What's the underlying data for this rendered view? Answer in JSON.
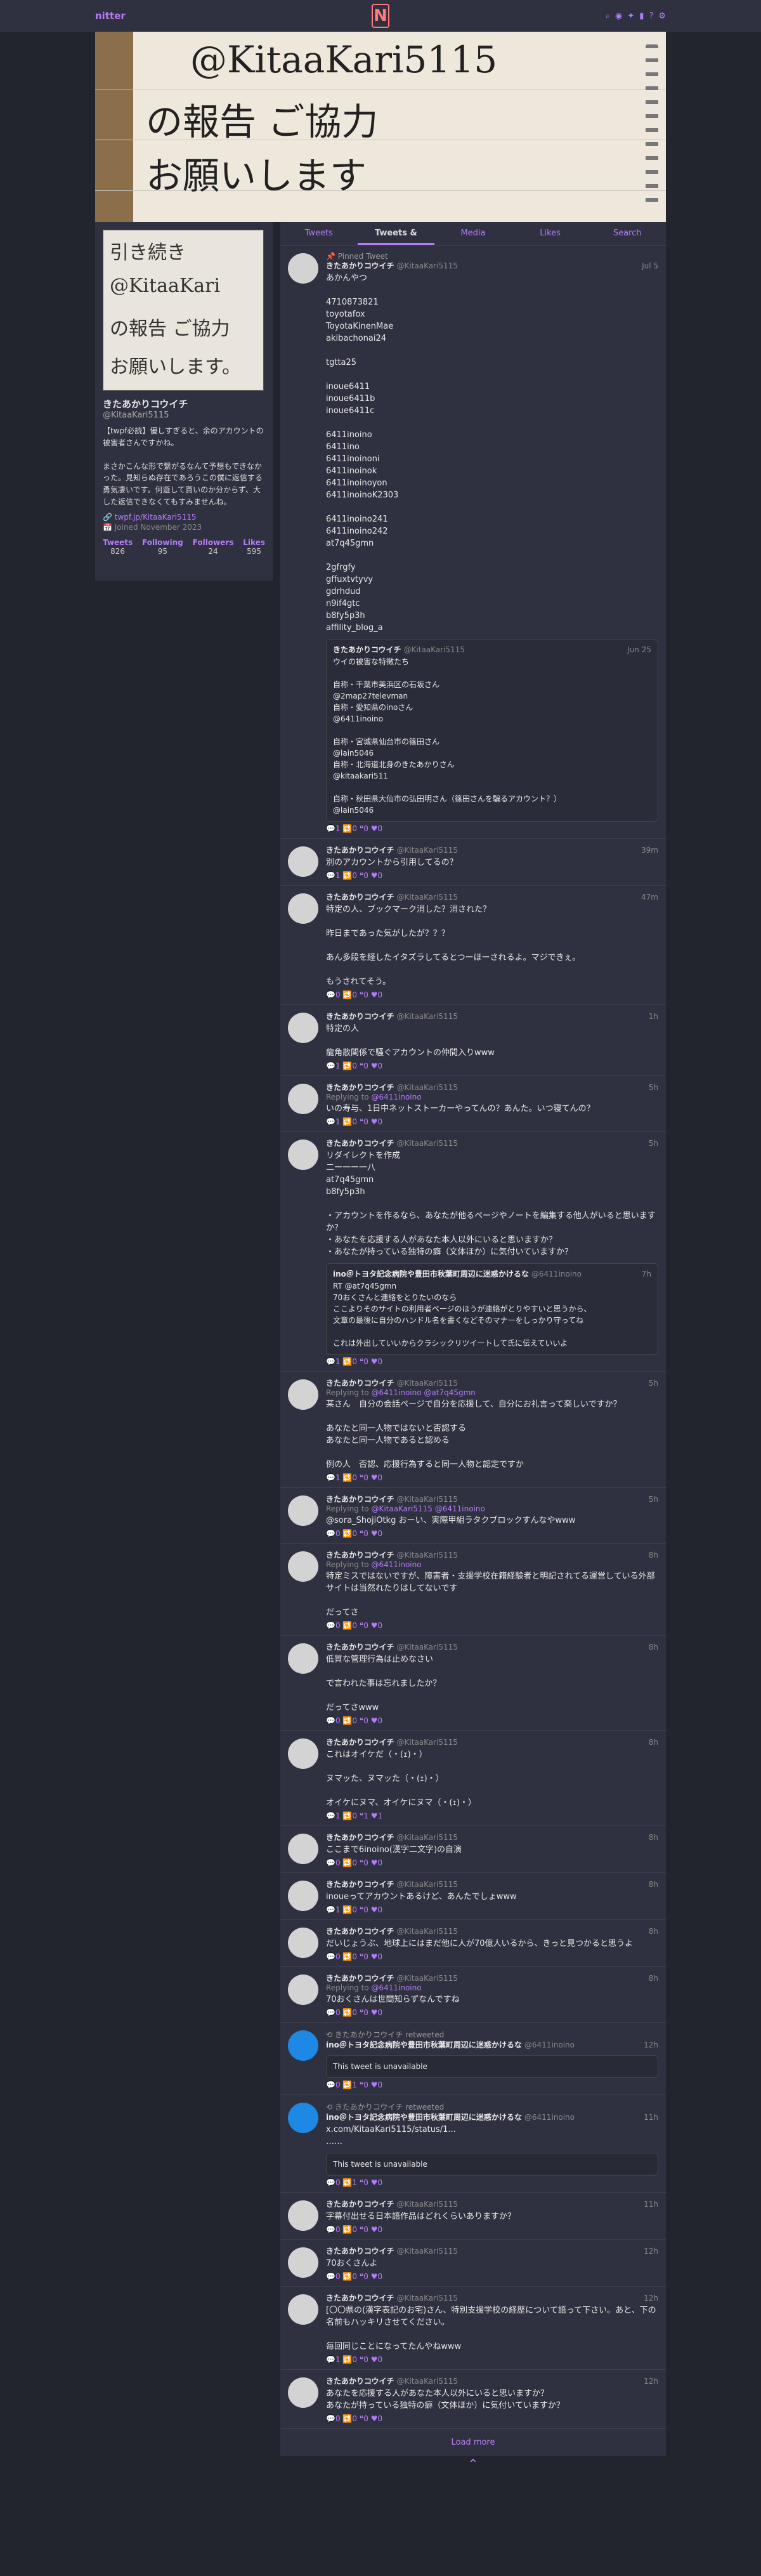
{
  "nav": {
    "brand": "nitter",
    "logo": "N",
    "icons": [
      "search-icon",
      "rss-icon",
      "twitter-icon",
      "chart-icon",
      "help-icon",
      "gear-icon"
    ]
  },
  "banner": {
    "lines": [
      "@KitaaKari5115",
      "の報告 ご協力",
      "お願いします"
    ]
  },
  "profile": {
    "avatar_lines": [
      "引き続き",
      "@KitaaKari",
      "の報告 ご協力",
      "お願いします。"
    ],
    "fullname": "きたあかりコウイチ",
    "username": "@KitaaKari5115",
    "bio": "【twpf必読】優しすぎると、余のアカウントの被害者さんですかね。\n\nまさかこんな形で繋がるなんて予想もできなかった。見知らぬ存在であろうこの僕に返信する勇気凄いです。何遊して貰いのか分からず、大した返信できなくてもすみませんね。",
    "link": "twpf.jp/KitaaKari5115",
    "joined": "Joined November 2023",
    "stats": [
      {
        "label": "Tweets",
        "value": "826"
      },
      {
        "label": "Following",
        "value": "95"
      },
      {
        "label": "Followers",
        "value": "24"
      },
      {
        "label": "Likes",
        "value": "595"
      }
    ]
  },
  "tabs": [
    "Tweets",
    "Tweets & Replies",
    "Media",
    "Likes",
    "Search"
  ],
  "tweets": [
    {
      "pinned": "Pinned Tweet",
      "fn": "きたあかりコウイチ",
      "un": "@KitaaKari5115",
      "date": "Jul 5",
      "body": "あかんやつ\n\n4710873821\ntoyotafox\nToyotaKinenMae\nakibachonai24\n\ntgtta25\n\ninoue6411\ninoue6411b\ninoue6411c\n\n6411inoino\n6411ino\n6411inoinoni\n6411inoinok\n6411inoinoyon\n6411inoinoK2303\n\n6411inoino241\n6411inoino242\nat7q45gmn\n\n2gfrgfy\ngffuxtvtyvy\ngdrhdud\nn9if4gtc\nb8fy5p3h\naffility_blog_a",
      "quote": {
        "fn": "きたあかりコウイチ",
        "un": "@KitaaKari5115",
        "date": "Jun 25",
        "body": "ウイの被害な特徴たち\n\n自称・千葉市美浜区の石坂さん\n@2map27televman\n自称・愛知県のinoさん\n@6411inoino\n\n自称・宮城県仙台市の篠田さん\n@lain5046\n自称・北海道北身のきたあかりさん\n@kitaakari511\n\n自称・秋田県大仙市の弘田明さん（篠田さんを騙るアカウント？）\n@lain5046"
      },
      "stats": "💬1 🔁0 ❝0 ♥0"
    },
    {
      "fn": "きたあかりコウイチ",
      "un": "@KitaaKari5115",
      "date": "39m",
      "body": "別のアカウントから引用してるの？",
      "stats": "💬1 🔁0 ❝0 ♥0"
    },
    {
      "fn": "きたあかりコウイチ",
      "un": "@KitaaKari5115",
      "date": "47m",
      "body": "特定の人、ブックマーク消した？消された？\n\n昨日まであった気がしたが？？？\n\nあん多段を経したイタズラしてるとつーほーされるよ。マジできぇ。\n\nもうされてそう。",
      "stats": "💬0 🔁0 ❝0 ♥0"
    },
    {
      "fn": "きたあかりコウイチ",
      "un": "@KitaaKari5115",
      "date": "1h",
      "body": "特定の人\n\n龍角散関係で騒ぐアカウントの仲間入りwww",
      "stats": "💬1 🔁0 ❝0 ♥0"
    },
    {
      "fn": "きたあかりコウイチ",
      "un": "@KitaaKari5115",
      "date": "5h",
      "reply": "@6411inoino",
      "body": "いの寿与、1日中ネットストーカーやってんの？あんた。いつ寝てんの？",
      "stats": "💬1 🔁0 ❝0 ♥0"
    },
    {
      "fn": "きたあかりコウイチ",
      "un": "@KitaaKari5115",
      "date": "5h",
      "body": "リダイレクトを作成\n二ー一ー一八\nat7q45gmn\nb8fy5p3h\n\n・アカウントを作るなら、あなたが他るページやノートを編集する他人がいると思いますか？\n・あなたを応援する人があなた本人以外にいると思いますか？\n・あなたが持っている独特の癖（文体ほか）に気付いていますか？",
      "quote": {
        "fn": "ino＠トヨタ記念病院や豊田市秋葉町周辺に迷惑かけるな",
        "un": "@6411inoino",
        "date": "7h",
        "body": "RT @at7q45gmn\n70おくさんと連絡をとりたいのなら\nここよりそのサイトの利用者ページのほうが連絡がとりやすいと思うから、\n文章の最後に自分のハンドル名を書くなどそのマナーをしっかり守ってね\n\nこれは外出していいからクラシックリツイートして氏に伝えていいよ"
      },
      "stats": "💬1 🔁0 ❝0 ♥0"
    },
    {
      "fn": "きたあかりコウイチ",
      "un": "@KitaaKari5115",
      "date": "5h",
      "reply": "@6411inoino @at7q45gmn",
      "body": "某さん　自分の会話ページで自分を応援して、自分にお礼言って楽しいですか？\n\nあなたと同一人物ではないと否認する\nあなたと同一人物であると認める\n\n例の人　否認、応援行為すると同一人物と認定ですか",
      "stats": "💬1 🔁0 ❝0 ♥0"
    },
    {
      "fn": "きたあかりコウイチ",
      "un": "@KitaaKari5115",
      "date": "5h",
      "reply": "@KitaaKari5115 @6411inoino",
      "body": "@sora_ShojiOtkg おーい、実際甲組ラタクブロックすんなやwww",
      "stats": "💬0 🔁0 ❝0 ♥0"
    },
    {
      "fn": "きたあかりコウイチ",
      "un": "@KitaaKari5115",
      "date": "8h",
      "reply": "@6411inoino",
      "body": "特定ミスではないですが、障害者・支援学校在籍経験者と明記されてる運営している外部サイトは当然れたりはしてないです\n\nだってさ",
      "stats": "💬0 🔁0 ❝0 ♥0"
    },
    {
      "fn": "きたあかりコウイチ",
      "un": "@KitaaKari5115",
      "date": "8h",
      "body": "低質な管理行為は止めなさい\n\nで言われた事は忘れましたか？\n\nだってさwww",
      "stats": "💬0 🔁0 ❝0 ♥0"
    },
    {
      "fn": "きたあかりコウイチ",
      "un": "@KitaaKari5115",
      "date": "8h",
      "body": "これはオイケだ（・(ｪ)・）\n\nヌマッた、ヌマッた（・(ｪ)・）\n\nオイケにヌマ、オイケにヌマ（・(ｪ)・）",
      "stats": "💬1 🔁0 ❝1 ♥1"
    },
    {
      "fn": "きたあかりコウイチ",
      "un": "@KitaaKari5115",
      "date": "8h",
      "body": "ここまで6inoino(漢字二文字)の自演",
      "stats": "💬0 🔁0 ❝0 ♥0"
    },
    {
      "fn": "きたあかりコウイチ",
      "un": "@KitaaKari5115",
      "date": "8h",
      "body": "inoueってアカウントあるけど、あんたでしょwww",
      "stats": "💬1 🔁0 ❝0 ♥0"
    },
    {
      "fn": "きたあかりコウイチ",
      "un": "@KitaaKari5115",
      "date": "8h",
      "body": "だいじょうぶ、地球上にはまだ他に人が70億人いるから、きっと見つかると思うよ",
      "stats": "💬0 🔁0 ❝0 ♥0"
    },
    {
      "fn": "きたあかりコウイチ",
      "un": "@KitaaKari5115",
      "date": "8h",
      "reply": "@6411inoino",
      "body": "70おくさんは世間知らずなんですね",
      "stats": "💬0 🔁0 ❝0 ♥0"
    },
    {
      "rt": "きたあかりコウイチ retweeted",
      "blue": true,
      "fn": "ino＠トヨタ記念病院や豊田市秋葉町周辺に迷惑かけるな",
      "un": "@6411inoino",
      "date": "12h",
      "unavailable": "This tweet is unavailable",
      "stats": "💬0 🔁1 ❝0 ♥0"
    },
    {
      "rt": "きたあかりコウイチ retweeted",
      "blue": true,
      "fn": "ino＠トヨタ記念病院や豊田市秋葉町周辺に迷惑かけるな",
      "un": "@6411inoino",
      "date": "11h",
      "body": "x.com/KitaaKari5115/status/1...\n……",
      "unavailable": "This tweet is unavailable",
      "stats": "💬0 🔁1 ❝0 ♥0"
    },
    {
      "fn": "きたあかりコウイチ",
      "un": "@KitaaKari5115",
      "date": "11h",
      "body": "字幕付出せる日本語作品はどれくらいありますか？",
      "stats": "💬0 🔁0 ❝0 ♥0"
    },
    {
      "fn": "きたあかりコウイチ",
      "un": "@KitaaKari5115",
      "date": "12h",
      "body": "70おくさんよ",
      "stats": "💬0 🔁0 ❝0 ♥0"
    },
    {
      "fn": "きたあかりコウイチ",
      "un": "@KitaaKari5115",
      "date": "12h",
      "body": "[〇〇県の(漢字表記のお宅)さん、特別支援学校の経歴について語って下さい。あと、下の名前もハッキリさせてください。\n\n毎回同じことになってたんやねwww",
      "stats": "💬1 🔁0 ❝0 ♥0"
    },
    {
      "fn": "きたあかりコウイチ",
      "un": "@KitaaKari5115",
      "date": "12h",
      "body": "あなたを応援する人があなた本人以外にいると思いますか？\nあなたが持っている独特の癖（文体ほか）に気付いていますか？",
      "stats": "💬0 🔁0 ❝0 ♥0"
    }
  ],
  "footer": {
    "load_more": "Load more",
    "top": "⌃"
  }
}
